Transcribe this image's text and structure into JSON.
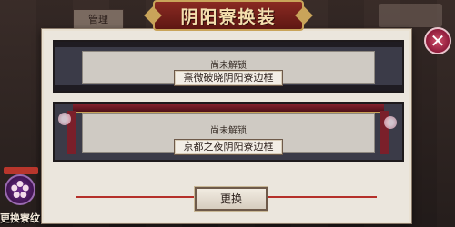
{
  "background": {
    "tab_label": "管理"
  },
  "dialog": {
    "title": "阴阳寮换装"
  },
  "frames": [
    {
      "status": "尚未解锁",
      "name": "熹微破晓阴阳寮边框"
    },
    {
      "status": "尚未解锁",
      "name": "京都之夜阴阳寮边框"
    }
  ],
  "change_button": {
    "label": "更换"
  },
  "crest_button": {
    "label": "更换寮纹"
  },
  "colors": {
    "accent_red": "#b5302a",
    "banner_red": "#8a2a22",
    "gold": "#c9a45a",
    "close_pink": "#d0506a"
  },
  "icons": {
    "close": "close-icon",
    "crest": "sakura-crest-icon",
    "blossom": "sakura-blossom-icon"
  }
}
